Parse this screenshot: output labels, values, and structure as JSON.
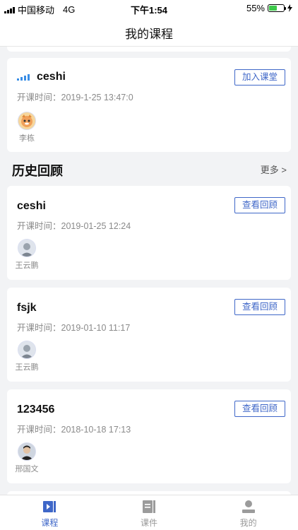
{
  "status_bar": {
    "carrier": "中国移动",
    "network": "4G",
    "time": "下午1:54",
    "battery_percent_label": "55%",
    "battery_level": 0.55
  },
  "nav": {
    "title": "我的课程"
  },
  "live_course": {
    "title": "ceshi",
    "time_label": "开课时间：2019-1-25 13:47:0",
    "button_label": "加入课堂",
    "teacher": "李栋",
    "status_icon": "live-signal-icon"
  },
  "history": {
    "section_title": "历史回顾",
    "more_label": "更多 >",
    "courses": [
      {
        "title": "ceshi",
        "time_label": "开课时间：2019-01-25 12:24",
        "button_label": "查看回顾",
        "teacher": "王云鹏"
      },
      {
        "title": "fsjk",
        "time_label": "开课时间：2019-01-10 11:17",
        "button_label": "查看回顾",
        "teacher": "王云鹏"
      },
      {
        "title": "123456",
        "time_label": "开课时间：2018-10-18 17:13",
        "button_label": "查看回顾",
        "teacher": "邢国文"
      }
    ]
  },
  "tab_bar": {
    "tabs": [
      {
        "label": "课程",
        "icon": "course-icon",
        "active": true
      },
      {
        "label": "课件",
        "icon": "courseware-icon",
        "active": false
      },
      {
        "label": "我的",
        "icon": "profile-icon",
        "active": false
      }
    ]
  },
  "colors": {
    "accent": "#3f67c8",
    "live": "#3a8ee6",
    "battery": "#3dc94a"
  }
}
